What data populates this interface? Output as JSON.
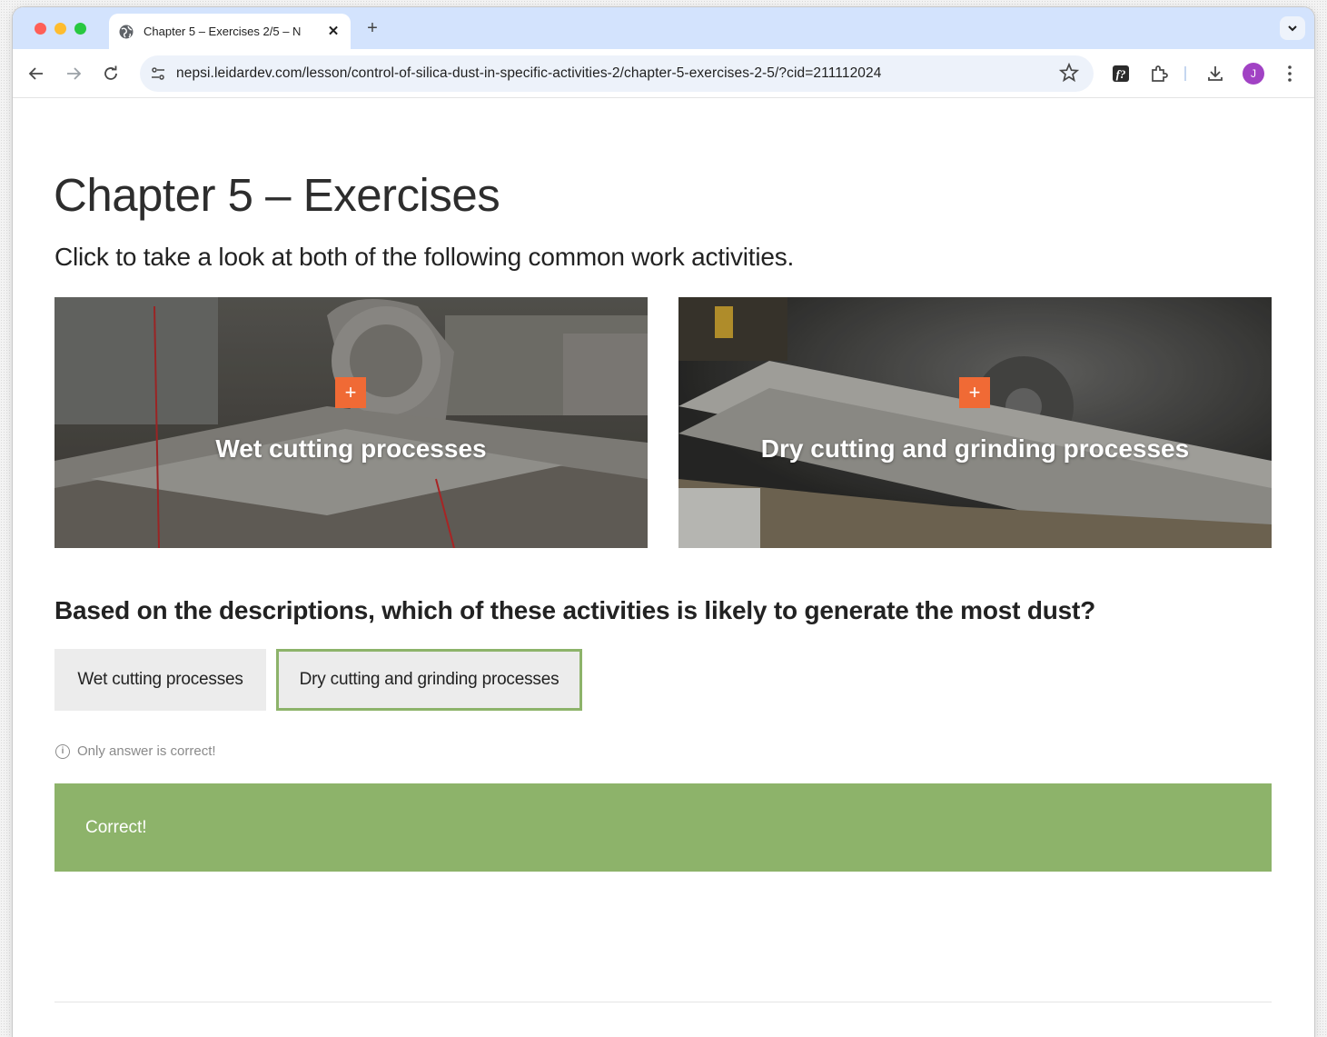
{
  "browser": {
    "tab_title": "Chapter 5 – Exercises 2/5 – N",
    "url": "nepsi.leidardev.com/lesson/control-of-silica-dust-in-specific-activities-2/chapter-5-exercises-2-5/?cid=211112024",
    "avatar_initial": "J",
    "new_tab_label": "+",
    "close_label": "✕"
  },
  "page": {
    "title": "Chapter 5 – Exercises",
    "intro": "Click to take a look at both of the following common work activities.",
    "cards": [
      {
        "label": "Wet cutting processes",
        "plus": "+"
      },
      {
        "label": "Dry cutting and grinding processes",
        "plus": "+"
      }
    ],
    "question": "Based on the descriptions, which of these activities is likely to generate the most dust?",
    "answers": [
      {
        "label": "Wet cutting processes",
        "selected": false
      },
      {
        "label": "Dry cutting and grinding processes",
        "selected": true
      }
    ],
    "hint_icon_glyph": "i",
    "hint": "Only answer is correct!",
    "feedback": "Correct!"
  },
  "colors": {
    "accent_orange": "#f06a35",
    "correct_green": "#8db36a",
    "tabstrip": "#d3e3fd",
    "avatar": "#a142c4"
  },
  "icons": [
    "globe-icon",
    "close-icon",
    "back-icon",
    "forward-icon",
    "reload-icon",
    "site-info-icon",
    "star-icon",
    "extension-f-icon",
    "puzzle-icon",
    "download-icon",
    "more-icon",
    "chevron-down-icon",
    "info-icon",
    "plus-icon"
  ]
}
